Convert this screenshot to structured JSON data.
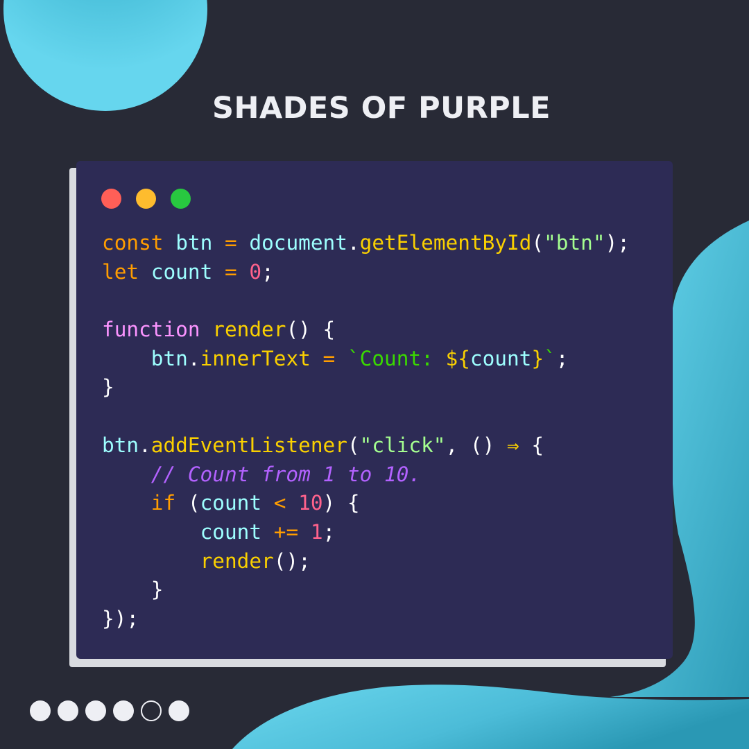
{
  "title": "SHADES OF PURPLE",
  "window": {
    "buttons": [
      {
        "name": "close",
        "color": "#ff5f57"
      },
      {
        "name": "minimize",
        "color": "#febc2e"
      },
      {
        "name": "maximize",
        "color": "#28c840"
      }
    ]
  },
  "code": {
    "language": "javascript",
    "lines": [
      [
        {
          "text": "const",
          "color": "#ff9d00"
        },
        {
          "text": " ",
          "color": "#ffffff"
        },
        {
          "text": "btn",
          "color": "#9effff"
        },
        {
          "text": " ",
          "color": "#ffffff"
        },
        {
          "text": "=",
          "color": "#ff9d00"
        },
        {
          "text": " ",
          "color": "#ffffff"
        },
        {
          "text": "document",
          "color": "#9effff"
        },
        {
          "text": ".",
          "color": "#ffffff"
        },
        {
          "text": "getElementById",
          "color": "#fad000"
        },
        {
          "text": "(",
          "color": "#ffffff"
        },
        {
          "text": "\"btn\"",
          "color": "#a5ff90"
        },
        {
          "text": ");",
          "color": "#ffffff"
        }
      ],
      [
        {
          "text": "let",
          "color": "#ff9d00"
        },
        {
          "text": " ",
          "color": "#ffffff"
        },
        {
          "text": "count",
          "color": "#9effff"
        },
        {
          "text": " ",
          "color": "#ffffff"
        },
        {
          "text": "=",
          "color": "#ff9d00"
        },
        {
          "text": " ",
          "color": "#ffffff"
        },
        {
          "text": "0",
          "color": "#ff628c"
        },
        {
          "text": ";",
          "color": "#ffffff"
        }
      ],
      [],
      [
        {
          "text": "function",
          "color": "#fb94ff"
        },
        {
          "text": " ",
          "color": "#ffffff"
        },
        {
          "text": "render",
          "color": "#fad000"
        },
        {
          "text": "() {",
          "color": "#ffffff"
        }
      ],
      [
        {
          "text": "    ",
          "color": "#ffffff"
        },
        {
          "text": "btn",
          "color": "#9effff"
        },
        {
          "text": ".",
          "color": "#ffffff"
        },
        {
          "text": "innerText",
          "color": "#fad000"
        },
        {
          "text": " ",
          "color": "#ffffff"
        },
        {
          "text": "=",
          "color": "#ff9d00"
        },
        {
          "text": " ",
          "color": "#ffffff"
        },
        {
          "text": "`Count: ",
          "color": "#3ad900"
        },
        {
          "text": "${",
          "color": "#fad000"
        },
        {
          "text": "count",
          "color": "#9effff"
        },
        {
          "text": "}",
          "color": "#fad000"
        },
        {
          "text": "`",
          "color": "#3ad900"
        },
        {
          "text": ";",
          "color": "#ffffff"
        }
      ],
      [
        {
          "text": "}",
          "color": "#ffffff"
        }
      ],
      [],
      [
        {
          "text": "btn",
          "color": "#9effff"
        },
        {
          "text": ".",
          "color": "#ffffff"
        },
        {
          "text": "addEventListener",
          "color": "#fad000"
        },
        {
          "text": "(",
          "color": "#ffffff"
        },
        {
          "text": "\"click\"",
          "color": "#a5ff90"
        },
        {
          "text": ", () ",
          "color": "#ffffff"
        },
        {
          "text": "⇒",
          "color": "#fad000"
        },
        {
          "text": " {",
          "color": "#ffffff"
        }
      ],
      [
        {
          "text": "    ",
          "color": "#ffffff"
        },
        {
          "text": "// Count from 1 to 10.",
          "color": "#b362ff",
          "italic": true
        }
      ],
      [
        {
          "text": "    ",
          "color": "#ffffff"
        },
        {
          "text": "if",
          "color": "#ff9d00"
        },
        {
          "text": " (",
          "color": "#ffffff"
        },
        {
          "text": "count",
          "color": "#9effff"
        },
        {
          "text": " ",
          "color": "#ffffff"
        },
        {
          "text": "<",
          "color": "#ff9d00"
        },
        {
          "text": " ",
          "color": "#ffffff"
        },
        {
          "text": "10",
          "color": "#ff628c"
        },
        {
          "text": ") {",
          "color": "#ffffff"
        }
      ],
      [
        {
          "text": "        ",
          "color": "#ffffff"
        },
        {
          "text": "count",
          "color": "#9effff"
        },
        {
          "text": " ",
          "color": "#ffffff"
        },
        {
          "text": "+=",
          "color": "#ff9d00"
        },
        {
          "text": " ",
          "color": "#ffffff"
        },
        {
          "text": "1",
          "color": "#ff628c"
        },
        {
          "text": ";",
          "color": "#ffffff"
        }
      ],
      [
        {
          "text": "        ",
          "color": "#ffffff"
        },
        {
          "text": "render",
          "color": "#fad000"
        },
        {
          "text": "();",
          "color": "#ffffff"
        }
      ],
      [
        {
          "text": "    }",
          "color": "#ffffff"
        }
      ],
      [
        {
          "text": "});",
          "color": "#ffffff"
        }
      ]
    ]
  },
  "pagination": {
    "total": 6,
    "current": 5
  },
  "colors": {
    "background": "#282a36",
    "card": "#2d2b55",
    "accent_blob": "#5fd0e8",
    "title": "#eeeff4"
  }
}
